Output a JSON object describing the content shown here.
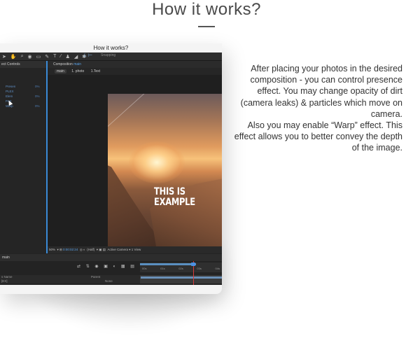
{
  "page": {
    "title": "How it works?"
  },
  "card": {
    "title": "How it works?"
  },
  "app": {
    "toolbar": {
      "tools": [
        "select-tool",
        "hand-tool",
        "zoom-tool",
        "camera-tool",
        "pan-tool",
        "rect-tool",
        "pen-tool",
        "text-tool",
        "brush-tool",
        "clone-tool",
        "eraser-tool",
        "puppet-tool"
      ],
      "snapping_label": "Snapping"
    },
    "effect_controls": {
      "tab_label": "ect Controls",
      "properties": [
        {
          "name": "Presen",
          "value": "0%"
        },
        {
          "name": "PLEX",
          "value": ""
        },
        {
          "name": "Elem",
          "value": "0%"
        },
        {
          "name": "Part",
          "value": ""
        },
        {
          "name": "Warp",
          "value": "0%"
        }
      ]
    },
    "composition": {
      "tab_label": "Composition",
      "tab_name": "main",
      "nav_main": "main",
      "nav_photo": "1. photo",
      "nav_text": "1.Text",
      "overlay_line1": "THIS IS",
      "overlay_line2": "EXAMPLE"
    },
    "status_bar": {
      "zoom": "50%",
      "timecode": "0:00:02:24",
      "resolution": "(Half)",
      "camera": "Active Camera",
      "view": "1 View"
    },
    "timeline": {
      "tab_label": "main",
      "ruler_labels": [
        "00s",
        "01s",
        "02s",
        "03s",
        "04s"
      ],
      "layer_name_header": "s Name",
      "layer_name": "[EX]",
      "parent_header": "Parent",
      "parent_value": "None"
    }
  },
  "description": {
    "paragraph1": "After placing your photos in the desired composition - you can control presence effect. You may change opacity of dirt (camera leaks) & particles which move on camera.",
    "paragraph2": "Also you may enable “Warp” effect. This effect allows you to better convey the depth of the image."
  }
}
